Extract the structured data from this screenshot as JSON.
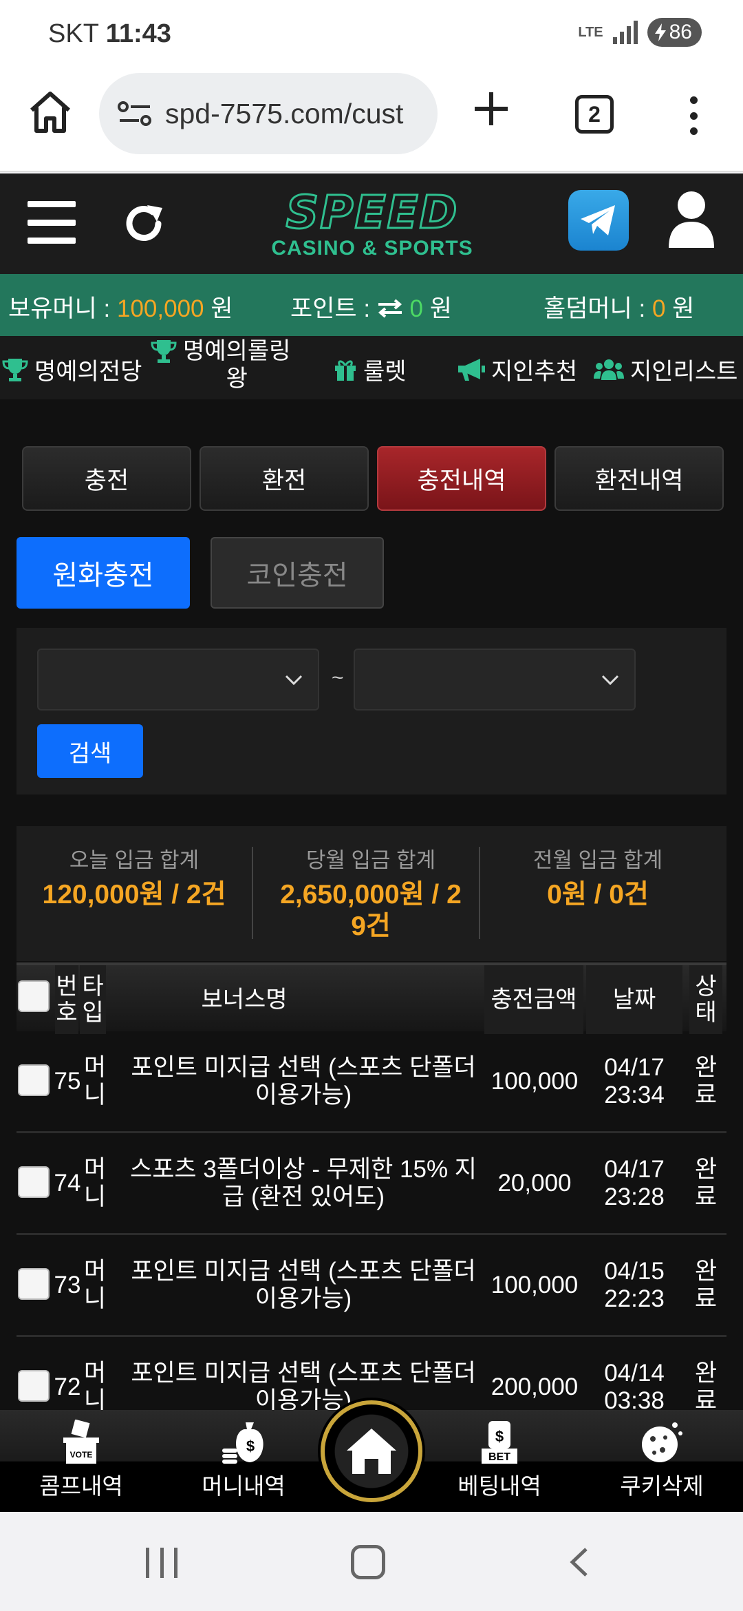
{
  "status_bar": {
    "carrier": "SKT",
    "time": "11:43",
    "network": "LTE",
    "battery": "86"
  },
  "browser": {
    "url": "spd-7575.com/cust",
    "tab_count": "2"
  },
  "site": {
    "logo_main": "SPEED",
    "logo_sub": "CASINO & SPORTS"
  },
  "money_bar": {
    "balance_label": "보유머니 : ",
    "balance_value": "100,000",
    "balance_unit": " 원",
    "points_label": "포인트 : ",
    "points_value": "0",
    "points_unit": " 원",
    "holdem_label": "홀덤머니 : ",
    "holdem_value": "0",
    "holdem_unit": " 원"
  },
  "nav_menu": {
    "hall_of_fame": "명예의전당",
    "rolling_king_1": "명예의롤링",
    "rolling_king_2": "왕",
    "roulette": "룰렛",
    "referral": "지인추천",
    "referral_list": "지인리스트"
  },
  "tabs": [
    "충전",
    "환전",
    "충전내역",
    "환전내역"
  ],
  "active_tab": "충전내역",
  "sub_tabs": {
    "won": "원화충전",
    "coin": "코인충전"
  },
  "filter": {
    "separator": "~",
    "search_label": "검색"
  },
  "summary": [
    {
      "label": "오늘 입금 합계",
      "value_line1": "120,000원 / 2건",
      "value_line2": ""
    },
    {
      "label": "당월 입금 합계",
      "value_line1": "2,650,000원 / 2",
      "value_line2": "9건"
    },
    {
      "label": "전월 입금 합계",
      "value_line1": "0원 / 0건",
      "value_line2": ""
    }
  ],
  "table": {
    "headers": {
      "no_1": "번",
      "no_2": "호",
      "type_1": "타",
      "type_2": "입",
      "bonus": "보너스명",
      "amount": "충전금액",
      "date": "날짜",
      "status_1": "상",
      "status_2": "태"
    },
    "rows": [
      {
        "no": "75",
        "type_1": "머",
        "type_2": "니",
        "bonus_1": "포인트 미지급 선택 (스포츠 단폴더",
        "bonus_2": "이용가능)",
        "amount": "100,000",
        "date_1": "04/17",
        "date_2": "23:34",
        "status_1": "완",
        "status_2": "료"
      },
      {
        "no": "74",
        "type_1": "머",
        "type_2": "니",
        "bonus_1": "스포츠 3폴더이상 - 무제한 15% 지",
        "bonus_2": "급 (환전 있어도)",
        "amount": "20,000",
        "date_1": "04/17",
        "date_2": "23:28",
        "status_1": "완",
        "status_2": "료"
      },
      {
        "no": "73",
        "type_1": "머",
        "type_2": "니",
        "bonus_1": "포인트 미지급 선택 (스포츠 단폴더",
        "bonus_2": "이용가능)",
        "amount": "100,000",
        "date_1": "04/15",
        "date_2": "22:23",
        "status_1": "완",
        "status_2": "료"
      },
      {
        "no": "72",
        "type_1": "머",
        "type_2": "니",
        "bonus_1": "포인트 미지급 선택 (스포츠 단폴더",
        "bonus_2": "이용가능)",
        "amount": "200,000",
        "date_1": "04/14",
        "date_2": "03:38",
        "status_1": "완",
        "status_2": "료"
      }
    ]
  },
  "bottom_nav": {
    "comp": "콤프내역",
    "money": "머니내역",
    "betting": "베팅내역",
    "cookie": "쿠키삭제",
    "icon_vote_text": "VOTE",
    "icon_bet_text": "BET"
  },
  "colors": {
    "accent_green": "#23775c",
    "accent_red": "#a8262a",
    "primary_blue": "#0d6efd",
    "amount_orange": "#f5a623"
  }
}
